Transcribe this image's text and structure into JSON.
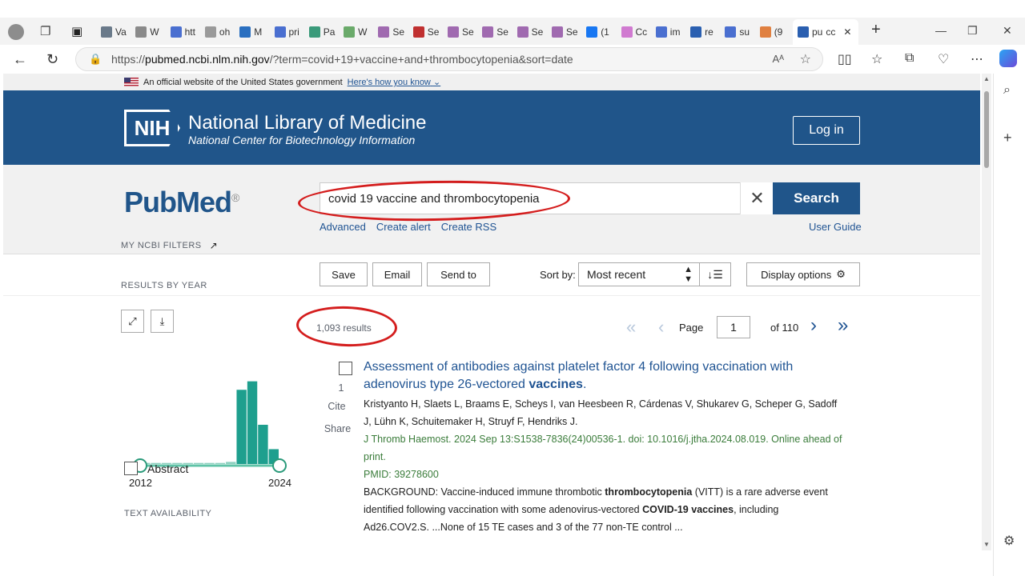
{
  "browser": {
    "tabs": [
      {
        "label": "Va",
        "fav": "#6a7a8a"
      },
      {
        "label": "W",
        "fav": "#8a8a8a"
      },
      {
        "label": "htt",
        "fav": "#4a6fd0"
      },
      {
        "label": "oh",
        "fav": "#9a9a9a"
      },
      {
        "label": "M",
        "fav": "#2a6fc0"
      },
      {
        "label": "pri",
        "fav": "#4a6fd0"
      },
      {
        "label": "Pa",
        "fav": "#3a9a7a"
      },
      {
        "label": "W",
        "fav": "#6aaa6a"
      },
      {
        "label": "Se",
        "fav": "#a06ab0"
      },
      {
        "label": "Se",
        "fav": "#c03030"
      },
      {
        "label": "Se",
        "fav": "#a06ab0"
      },
      {
        "label": "Se",
        "fav": "#a06ab0"
      },
      {
        "label": "Se",
        "fav": "#a06ab0"
      },
      {
        "label": "Se",
        "fav": "#a06ab0"
      },
      {
        "label": "(1",
        "fav": "#1877f2"
      },
      {
        "label": "Cc",
        "fav": "#d07ad0"
      },
      {
        "label": "im",
        "fav": "#4a6fd0"
      },
      {
        "label": "re",
        "fav": "#2a5fb0"
      },
      {
        "label": "su",
        "fav": "#4a6fd0"
      },
      {
        "label": "(9",
        "fav": "#e08040"
      },
      {
        "label": "pu",
        "fav": "#2a5fb0"
      }
    ],
    "active_tab_label": "pu",
    "active_tab_extra": "cc",
    "url_prefix": "https://",
    "url_host": "pubmed.ncbi.nlm.nih.gov",
    "url_rest": "/?term=covid+19+vaccine+and+thrombocytopenia&sort=date"
  },
  "gov_banner": {
    "text": "An official website of the United States government",
    "link": "Here's how you know"
  },
  "nih": {
    "logo": "NIH",
    "title": "National Library of Medicine",
    "subtitle": "National Center for Biotechnology Information",
    "login": "Log in"
  },
  "search": {
    "logo": "PubMed",
    "logo_mark": "®",
    "query": "covid 19 vaccine and thrombocytopenia",
    "button": "Search",
    "links": [
      "Advanced",
      "Create alert",
      "Create RSS"
    ],
    "user_guide": "User Guide"
  },
  "toolbar": {
    "save": "Save",
    "email": "Email",
    "send_to": "Send to",
    "sort_by": "Sort by:",
    "sort_value": "Most recent",
    "display_options": "Display options"
  },
  "filters": {
    "my_ncbi": "MY NCBI FILTERS",
    "results_by_year": "RESULTS BY YEAR",
    "year_start": "2012",
    "year_end": "2024",
    "text_availability": "TEXT AVAILABILITY",
    "abstract": "Abstract"
  },
  "chart_data": {
    "type": "bar",
    "categories": [
      "2012",
      "2013",
      "2014",
      "2015",
      "2016",
      "2017",
      "2018",
      "2019",
      "2020",
      "2021",
      "2022",
      "2023",
      "2024"
    ],
    "values": [
      1,
      1,
      1,
      1,
      1,
      1,
      1,
      1,
      2,
      70,
      78,
      37,
      14
    ],
    "ylim": [
      0,
      80
    ]
  },
  "results": {
    "count": "1,093 results",
    "page_label": "Page",
    "page": "1",
    "of_pages": "of 110"
  },
  "article": {
    "number": "1",
    "cite": "Cite",
    "share": "Share",
    "title_a": "Assessment of antibodies against platelet factor 4 following vaccination with adenovirus type 26-vectored ",
    "title_b": "vaccines",
    "title_c": ".",
    "authors": "Kristyanto H, Slaets L, Braams E, Scheys I, van Heesbeen R, Cárdenas V, Shukarev G, Scheper G, Sadoff J, Lühn K, Schuitemaker H, Struyf F, Hendriks J.",
    "journal": "J Thromb Haemost. 2024 Sep 13:S1538-7836(24)00536-1. doi: 10.1016/j.jtha.2024.08.019. Online ahead of print.",
    "pmid": "PMID: 39278600",
    "snip_1": "BACKGROUND: Vaccine-induced immune thrombotic ",
    "snip_2": "thrombocytopenia",
    "snip_3": " (VITT) is a rare adverse event identified following vaccination with some adenovirus-vectored ",
    "snip_4": "COVID-19 vaccines",
    "snip_5": ", including Ad26.COV2.S. ...None of 15 TE cases and 3 of the 77 non-TE control ..."
  }
}
